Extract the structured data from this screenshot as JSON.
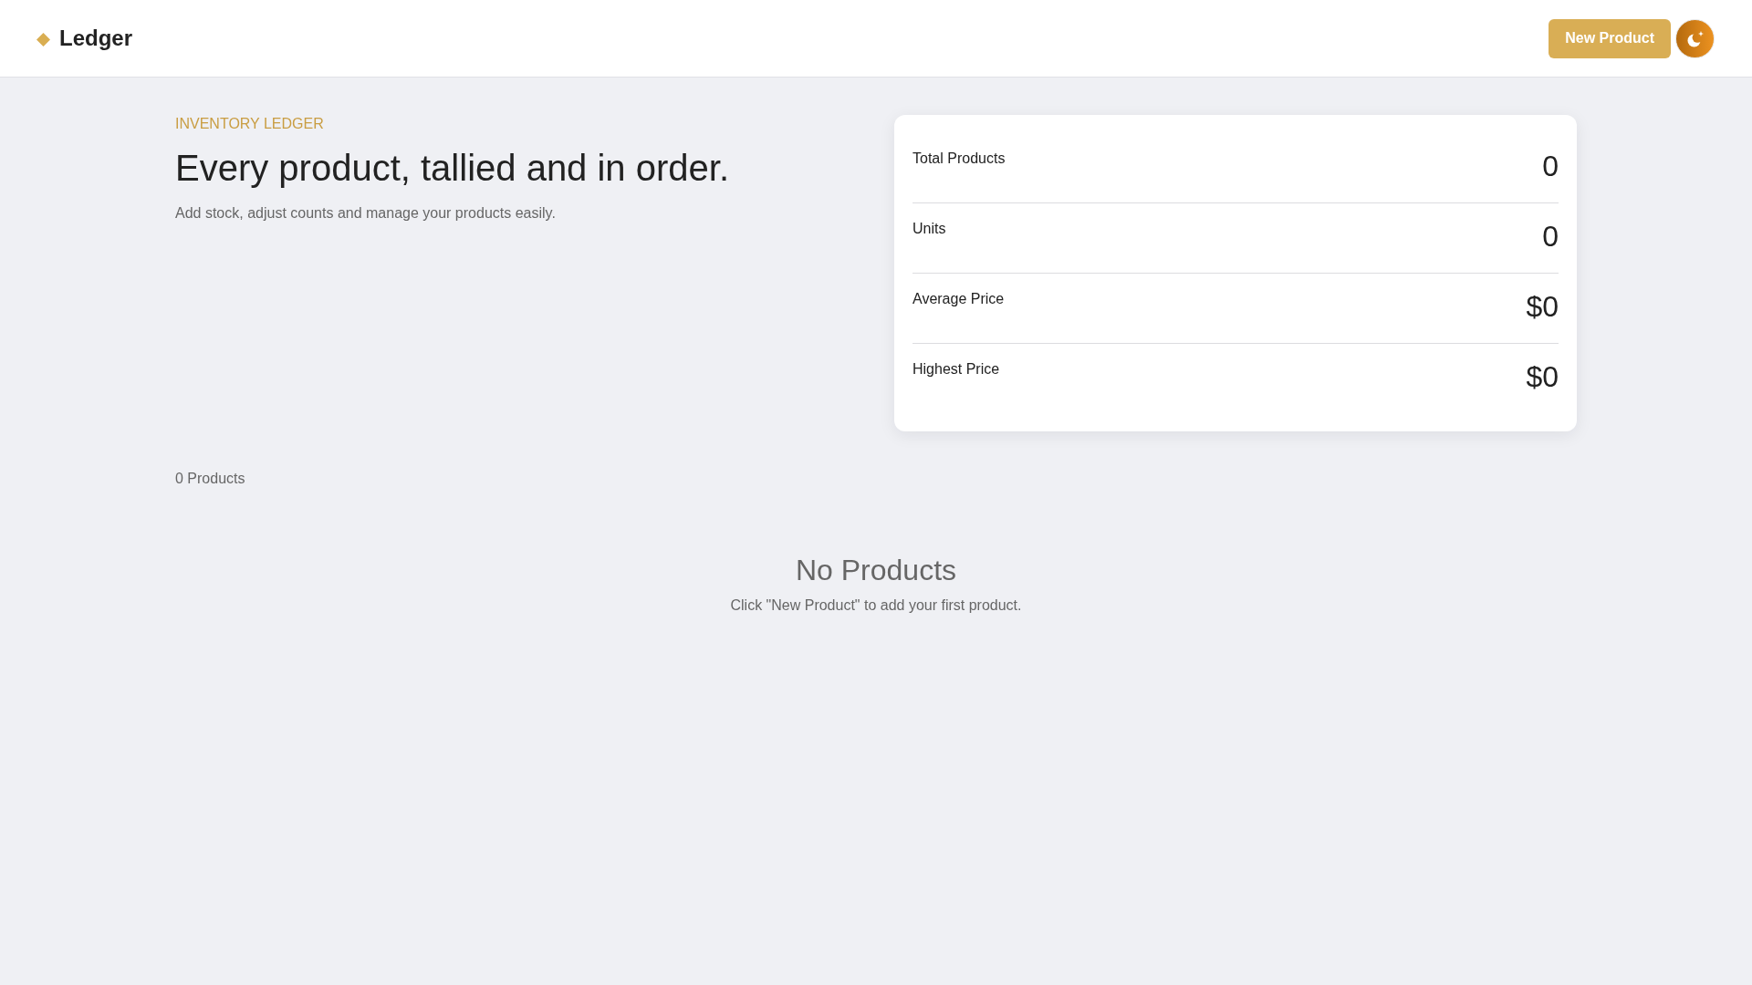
{
  "header": {
    "brand": "Ledger",
    "new_product_button": "New Product"
  },
  "hero": {
    "eyebrow": "INVENTORY LEDGER",
    "title": "Every product, tallied and in order.",
    "subtitle": "Add stock, adjust counts and manage your products easily."
  },
  "stats": [
    {
      "label": "Total Products",
      "value": "0"
    },
    {
      "label": "Units",
      "value": "0"
    },
    {
      "label": "Average Price",
      "value": "$0"
    },
    {
      "label": "Highest Price",
      "value": "$0"
    }
  ],
  "products": {
    "count": "0 Products",
    "empty_state": {
      "title": "No Products",
      "message": "Click \"New Product\" to add your first product."
    }
  }
}
